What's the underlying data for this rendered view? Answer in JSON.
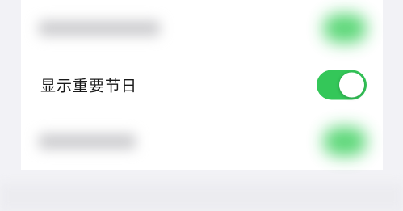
{
  "settings": {
    "highlight_row": {
      "label": "显示重要节日",
      "toggle_on": true
    }
  },
  "colors": {
    "background": "#f2f2f6",
    "row_background": "#ffffff",
    "toggle_on": "#34c759",
    "label_text": "#1a1a1a"
  }
}
